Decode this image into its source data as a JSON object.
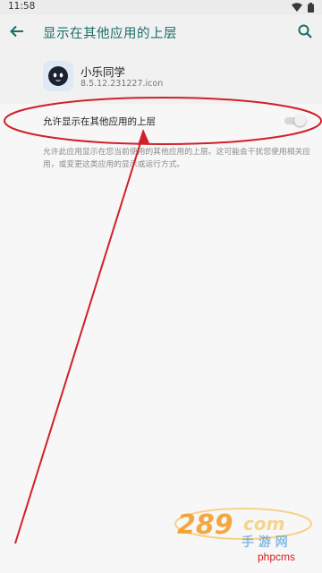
{
  "status_bar": {
    "time": "11:58",
    "icons": [
      "wifi-icon",
      "battery-icon"
    ]
  },
  "app_bar": {
    "title": "显示在其他应用的上层",
    "back_icon": "arrow-left-icon",
    "search_icon": "search-icon",
    "accent_color": "#1a6e68"
  },
  "app_info": {
    "name": "小乐同学",
    "version": "8.5.12.231227.icon"
  },
  "permission_toggle": {
    "label": "允许显示在其他应用的上层",
    "enabled": false
  },
  "description": "允许此应用显示在您当前使用的其他应用的上层。这可能会干扰您使用相关应用，或变更这类应用的显示或运行方式。",
  "watermark": {
    "site_text": "phpcms"
  },
  "annotation_color": "#d0202a"
}
